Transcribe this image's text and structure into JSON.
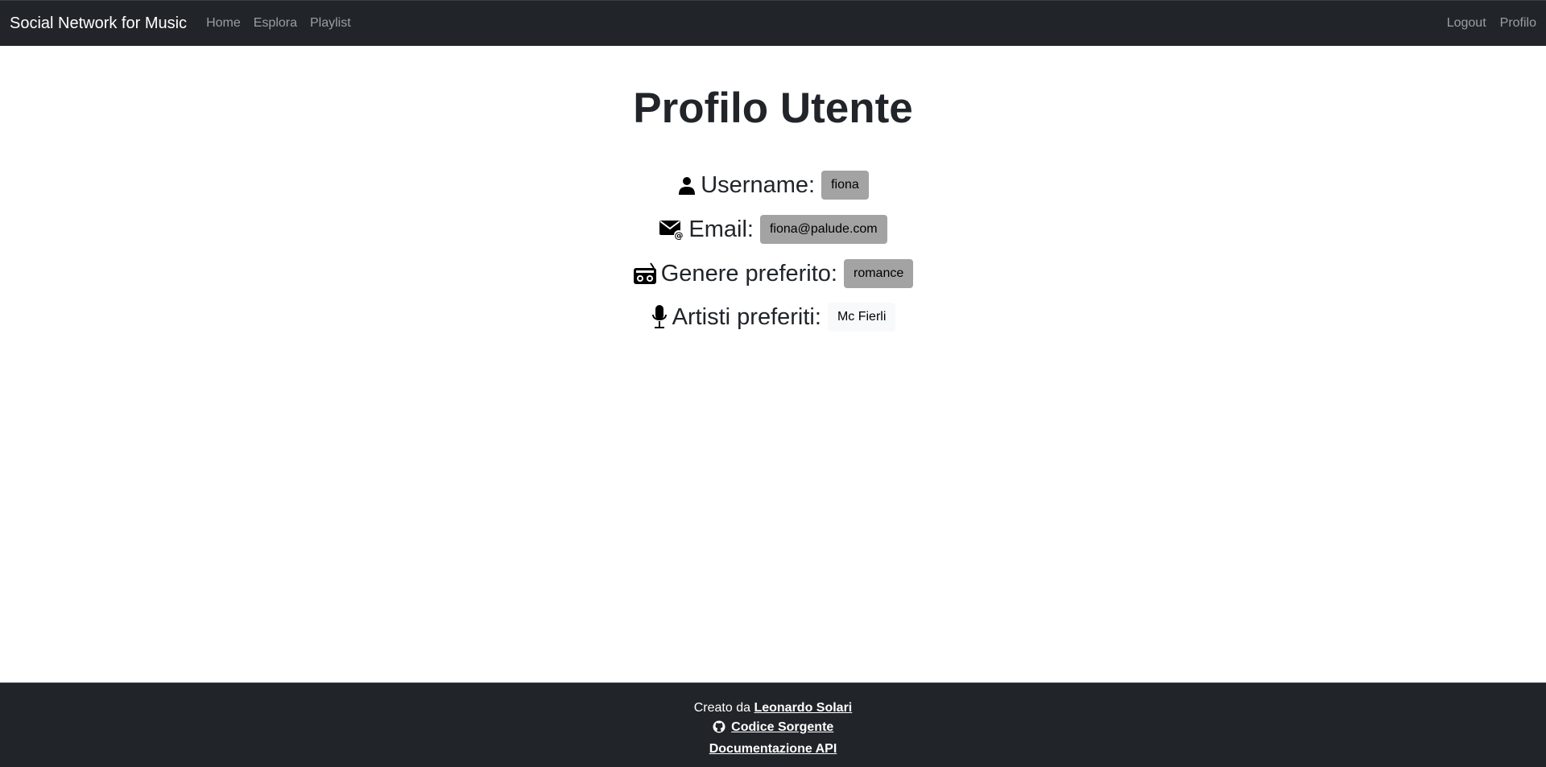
{
  "navbar": {
    "brand": "Social Network for Music",
    "links": [
      "Home",
      "Esplora",
      "Playlist"
    ],
    "right_links": [
      "Logout",
      "Profilo"
    ]
  },
  "page": {
    "title": "Profilo Utente"
  },
  "profile": {
    "username_label": "Username:",
    "username_value": "fiona",
    "email_label": "Email:",
    "email_value": "fiona@palude.com",
    "genre_label": "Genere preferito:",
    "genre_value": "romance",
    "artists_label": "Artisti preferiti:",
    "artists_value": "Mc Fierli"
  },
  "footer": {
    "created_by_prefix": "Creato da",
    "author": "Leonardo Solari",
    "source_link": "Codice Sorgente",
    "api_link": "Documentazione API"
  },
  "icons": {
    "user": "user-icon",
    "email": "envelope-at-icon",
    "genre": "boombox-icon",
    "artists": "microphone-icon",
    "github": "github-icon"
  },
  "colors": {
    "navbar_bg": "#212529",
    "badge_gray": "#a3a3a3",
    "badge_light": "#f8f9fa"
  }
}
